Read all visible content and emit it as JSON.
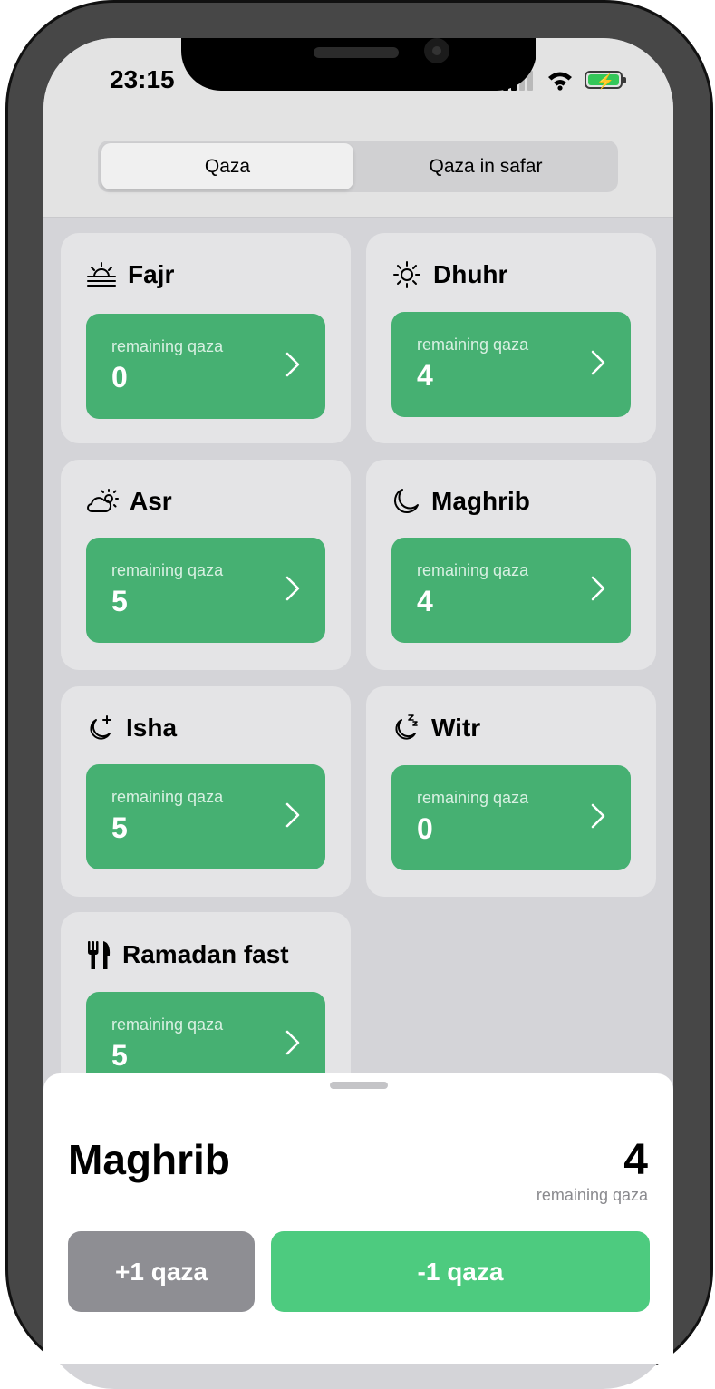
{
  "status_bar": {
    "time": "23:15",
    "icons": [
      "signal-icon",
      "wifi-icon",
      "battery-charging-icon"
    ]
  },
  "segmented_control": {
    "tabs": [
      {
        "label": "Qaza",
        "selected": true
      },
      {
        "label": "Qaza in safar",
        "selected": false
      }
    ]
  },
  "prayers": [
    {
      "name": "Fajr",
      "icon": "sunrise-icon",
      "label": "remaining qaza",
      "count": "0"
    },
    {
      "name": "Dhuhr",
      "icon": "sun-icon",
      "label": "remaining qaza",
      "count": "4"
    },
    {
      "name": "Asr",
      "icon": "cloud-sun-icon",
      "label": "remaining qaza",
      "count": "5"
    },
    {
      "name": "Maghrib",
      "icon": "moon-icon",
      "label": "remaining qaza",
      "count": "4"
    },
    {
      "name": "Isha",
      "icon": "moon-stars-icon",
      "label": "remaining qaza",
      "count": "5"
    },
    {
      "name": "Witr",
      "icon": "moon-zzz-icon",
      "label": "remaining qaza",
      "count": "0"
    },
    {
      "name": "Ramadan fast",
      "icon": "fork-knife-icon",
      "label": "remaining qaza",
      "count": "5"
    }
  ],
  "sheet": {
    "title": "Maghrib",
    "count": "4",
    "count_label": "remaining qaza",
    "plus_label": "+1 qaza",
    "minus_label": "-1 qaza"
  },
  "colors": {
    "accent_green": "#46b072",
    "button_green": "#4dcb7f",
    "button_gray": "#8e8e93"
  }
}
